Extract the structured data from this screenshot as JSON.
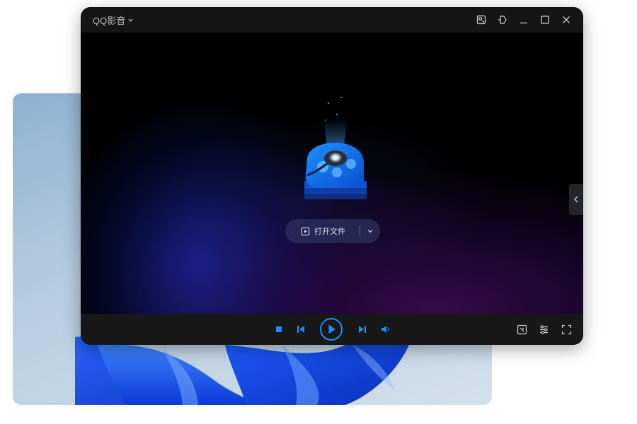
{
  "app": {
    "title": "QQ影音"
  },
  "main": {
    "open_file_label": "打开文件"
  },
  "icons": {
    "title_menu": "chevron-down-icon",
    "window": [
      "screenshot-icon",
      "pin-icon",
      "minimize-icon",
      "maximize-icon",
      "close-icon"
    ],
    "playback": [
      "stop-icon",
      "previous-icon",
      "play-icon",
      "next-icon",
      "volume-icon"
    ],
    "tools": [
      "video-edit-icon",
      "settings-icon",
      "fullscreen-icon"
    ],
    "side": "chevron-left-icon"
  },
  "colors": {
    "accent": "#1e8cff",
    "title_bar": "#151515",
    "control_bar": "#181818",
    "icon": "#cfcfcf"
  }
}
